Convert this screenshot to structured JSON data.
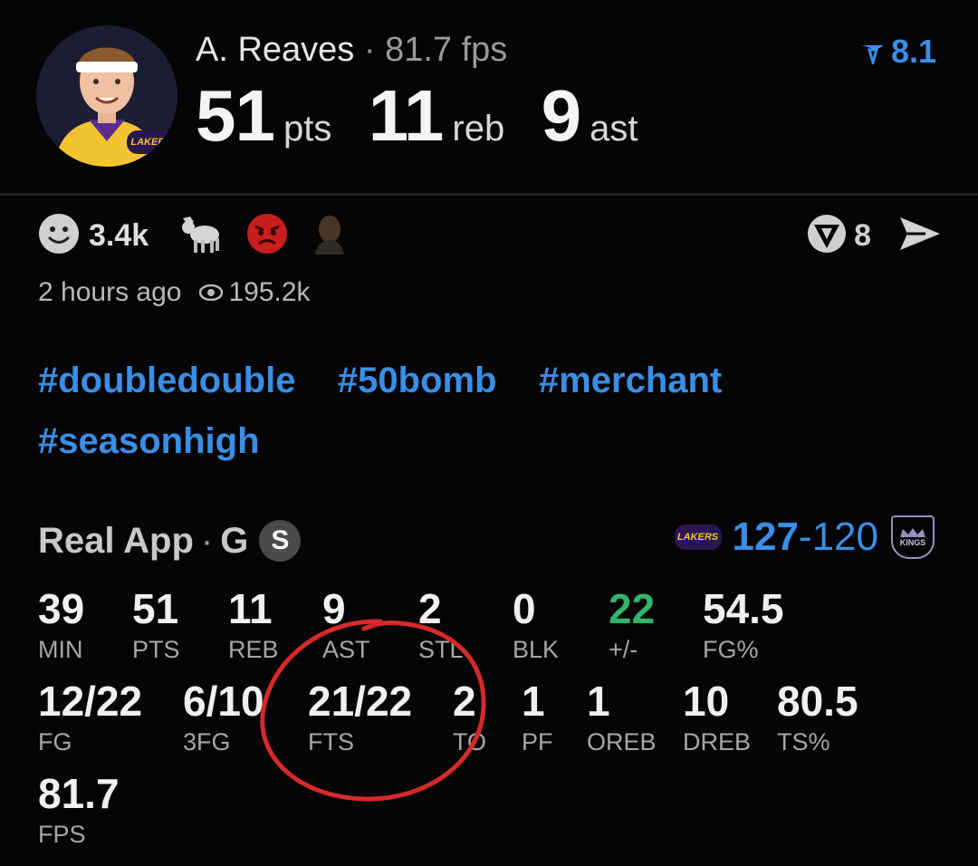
{
  "player": {
    "name": "A. Reaves",
    "separator": "·",
    "fps_text": "81.7 fps",
    "rating": "8.1",
    "headline": [
      {
        "value": "51",
        "unit": "pts"
      },
      {
        "value": "11",
        "unit": "reb"
      },
      {
        "value": "9",
        "unit": "ast"
      }
    ],
    "team_logo_text": "LAKERS"
  },
  "reactions": {
    "smile_count": "3.4k",
    "icons": [
      "smile-icon",
      "goat-icon",
      "angry-face-icon",
      "player-face-icon"
    ],
    "vote_count": "8"
  },
  "meta": {
    "time_ago": "2 hours ago",
    "views": "195.2k"
  },
  "tags": [
    "#doubledouble",
    "#50bomb",
    "#merchant",
    "#seasonhigh"
  ],
  "game": {
    "source": "Real App",
    "dot": "·",
    "position": "G",
    "badge": "S",
    "team_score": "127",
    "dash": "-",
    "opp_score": "120",
    "opp_logo_text": "KINGS"
  },
  "stats_row1": [
    {
      "value": "39",
      "label": "MIN"
    },
    {
      "value": "51",
      "label": "PTS"
    },
    {
      "value": "11",
      "label": "REB"
    },
    {
      "value": "9",
      "label": "AST"
    },
    {
      "value": "2",
      "label": "STL"
    },
    {
      "value": "0",
      "label": "BLK"
    },
    {
      "value": "22",
      "label": "+/-"
    },
    {
      "value": "54.5",
      "label": "FG%"
    }
  ],
  "stats_row2": [
    {
      "value": "12/22",
      "label": "FG"
    },
    {
      "value": "6/10",
      "label": "3FG"
    },
    {
      "value": "21/22",
      "label": "FTS"
    },
    {
      "value": "2",
      "label": "TO"
    },
    {
      "value": "1",
      "label": "PF"
    },
    {
      "value": "1",
      "label": "OREB"
    },
    {
      "value": "10",
      "label": "DREB"
    },
    {
      "value": "80.5",
      "label": "TS%"
    }
  ],
  "stats_row3": [
    {
      "value": "81.7",
      "label": "FPS"
    }
  ],
  "colors": {
    "accent_blue": "#3a8ee6",
    "positive_green": "#33b36b",
    "annotation_red": "#d62a2a"
  }
}
